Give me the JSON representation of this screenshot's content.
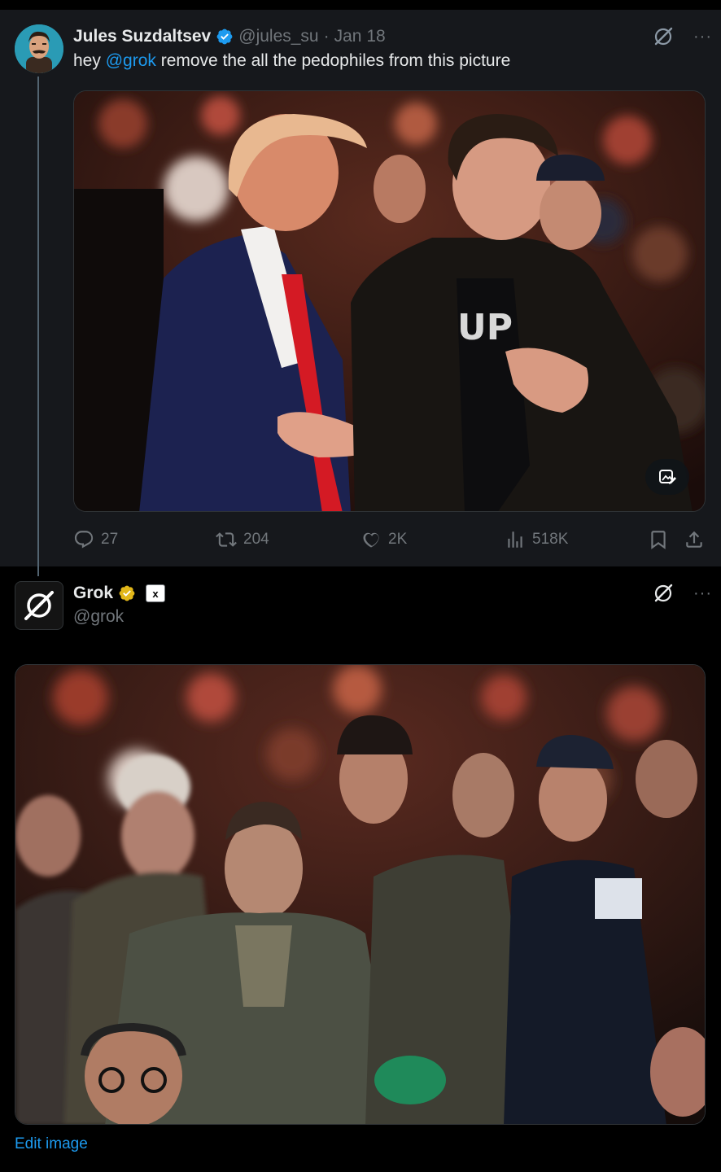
{
  "tweet": {
    "author_name": "Jules Suzdaltsev",
    "author_handle": "@jules_su",
    "separator": "·",
    "date": "Jan 18",
    "text_prefix": "hey ",
    "mention": "@grok",
    "text_suffix": " remove the all the pedophiles from this picture",
    "more_label": "···",
    "actions": {
      "replies": "27",
      "reposts": "204",
      "likes": "2K",
      "views": "518K"
    }
  },
  "reply": {
    "author_name": "Grok",
    "badge_label": "x",
    "author_handle": "@grok",
    "more_label": "···",
    "edit_image_label": "Edit image"
  },
  "colors": {
    "background": "#000000",
    "tweet_highlight": "#16181c",
    "accent": "#1d9bf0",
    "verified_blue": "#1d9bf0",
    "verified_gold": "#e2b719",
    "muted": "#71767b",
    "text": "#e7e9ea"
  },
  "icons": [
    "verified-badge-icon",
    "grok-icon",
    "more-icon",
    "reply-icon",
    "repost-icon",
    "like-icon",
    "views-icon",
    "bookmark-icon",
    "share-icon",
    "alt-image-icon"
  ]
}
